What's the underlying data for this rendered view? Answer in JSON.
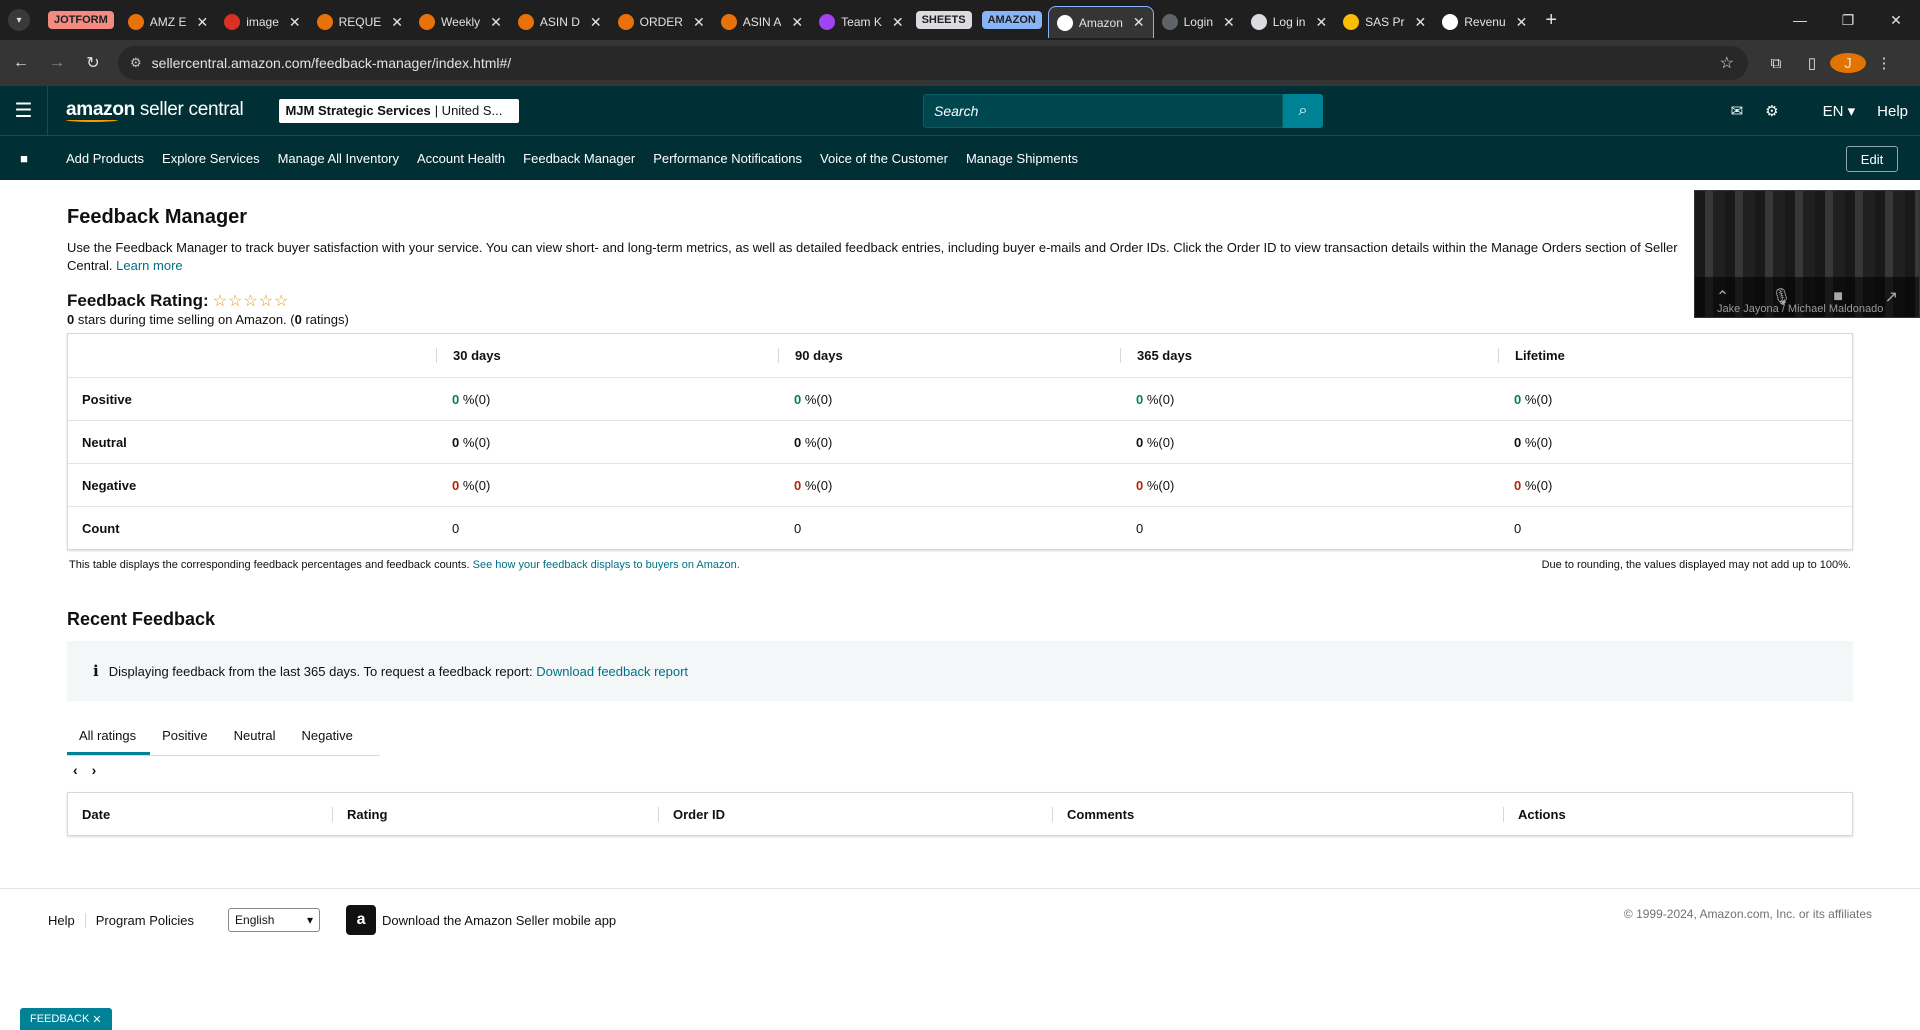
{
  "browser": {
    "tabs": [
      {
        "label": "JOTFORM",
        "type": "group",
        "bg": "#f28b82",
        "fg": "#1f1f1f"
      },
      {
        "label": "AMZ E",
        "fav_color": "#e8710a"
      },
      {
        "label": "image",
        "fav_color": "#d93025"
      },
      {
        "label": "REQUE",
        "fav_color": "#e8710a"
      },
      {
        "label": "Weekly",
        "fav_color": "#e8710a"
      },
      {
        "label": "ASIN D",
        "fav_color": "#e8710a"
      },
      {
        "label": "ORDER",
        "fav_color": "#e8710a"
      },
      {
        "label": "ASIN A",
        "fav_color": "#e8710a"
      },
      {
        "label": "Team K",
        "fav_color": "#a142f4"
      },
      {
        "label": "SHEETS",
        "type": "group",
        "bg": "#dadce0",
        "fg": "#1f1f1f"
      },
      {
        "label": "AMAZON",
        "type": "group",
        "bg": "#8ab4f8",
        "fg": "#1f1f1f"
      },
      {
        "label": "Amazon",
        "fav_color": "#ffffff",
        "active": true
      },
      {
        "label": "Login",
        "fav_color": "#5f6368"
      },
      {
        "label": "Log in",
        "fav_color": "#dadce0"
      },
      {
        "label": "SAS Pr",
        "fav_color": "#fbbc04"
      },
      {
        "label": "Revenu",
        "fav_color": "#ffffff"
      }
    ],
    "url": "sellercentral.amazon.com/feedback-manager/index.html#/",
    "profile_initial": "J"
  },
  "header": {
    "logo_text_bold": "amazon",
    "logo_text": " seller central",
    "account_name": "MJM Strategic Services",
    "account_region": "| United S...",
    "search_placeholder": "Search",
    "language": "EN",
    "help_label": "Help"
  },
  "nav": {
    "items": [
      "Add Products",
      "Explore Services",
      "Manage All Inventory",
      "Account Health",
      "Feedback Manager",
      "Performance Notifications",
      "Voice of the Customer",
      "Manage Shipments"
    ],
    "edit_label": "Edit"
  },
  "video": {
    "participants": "Jake Jayona / Michael Maldonado"
  },
  "page": {
    "title": "Feedback Manager",
    "intro": "Use the Feedback Manager to track buyer satisfaction with your service. You can view short- and long-term metrics, as well as detailed feedback entries, including buyer e-mails and Order IDs. Click the Order ID to view transaction details within the Manage Orders section of Seller Central.",
    "learn_more": "Learn more",
    "rating_title": "Feedback Rating:",
    "stars": "☆☆☆☆☆",
    "rating_stars_value": "0",
    "rating_sub_mid": " stars during time selling on Amazon. (",
    "rating_count": "0",
    "rating_sub_end": " ratings)"
  },
  "metrics": {
    "columns": [
      "30 days",
      "90 days",
      "365 days",
      "Lifetime"
    ],
    "rows": [
      {
        "label": "Positive",
        "kind": "pos",
        "cells": [
          {
            "num": "0",
            "rest": " %(0)"
          },
          {
            "num": "0",
            "rest": " %(0)"
          },
          {
            "num": "0",
            "rest": " %(0)"
          },
          {
            "num": "0",
            "rest": " %(0)"
          }
        ]
      },
      {
        "label": "Neutral",
        "kind": "neu",
        "cells": [
          {
            "num": "0",
            "rest": " %(0)"
          },
          {
            "num": "0",
            "rest": " %(0)"
          },
          {
            "num": "0",
            "rest": " %(0)"
          },
          {
            "num": "0",
            "rest": " %(0)"
          }
        ]
      },
      {
        "label": "Negative",
        "kind": "neg",
        "cells": [
          {
            "num": "0",
            "rest": " %(0)"
          },
          {
            "num": "0",
            "rest": " %(0)"
          },
          {
            "num": "0",
            "rest": " %(0)"
          },
          {
            "num": "0",
            "rest": " %(0)"
          }
        ]
      },
      {
        "label": "Count",
        "kind": "count",
        "cells": [
          {
            "num": "0",
            "rest": ""
          },
          {
            "num": "0",
            "rest": ""
          },
          {
            "num": "0",
            "rest": ""
          },
          {
            "num": "0",
            "rest": ""
          }
        ]
      }
    ],
    "note_left": "This table displays the corresponding feedback percentages and feedback counts.",
    "note_link": "See how your feedback displays to buyers on Amazon.",
    "note_right": "Due to rounding, the values displayed may not add up to 100%."
  },
  "recent": {
    "title": "Recent Feedback",
    "info_icon": "i",
    "info_text": "Displaying feedback from the last 365 days. To request a feedback report:",
    "info_link": "Download feedback report",
    "filter_tabs": [
      "All ratings",
      "Positive",
      "Neutral",
      "Negative"
    ],
    "table_headers": [
      "Date",
      "Rating",
      "Order ID",
      "Comments",
      "Actions"
    ]
  },
  "footer": {
    "help": "Help",
    "policies": "Program Policies",
    "language_select": "English",
    "app_text": "Download the Amazon Seller mobile app",
    "copyright": "© 1999-2024, Amazon.com, Inc. or its affiliates",
    "feedback_pill": "FEEDBACK"
  },
  "colors": {
    "header_bg": "#002f36",
    "accent": "#008296",
    "positive": "#067d62",
    "negative": "#b12704",
    "link": "#007185"
  }
}
